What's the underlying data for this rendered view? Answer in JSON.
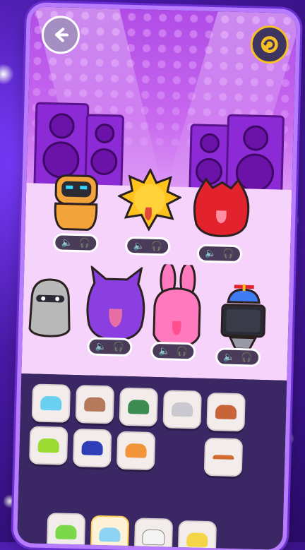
{
  "app": {
    "title": ""
  },
  "controls": {
    "back_icon": "arrow-left-icon",
    "reset_icon": "refresh-icon"
  },
  "characters": [
    {
      "name": "orange-robot",
      "color": "#f2a33a"
    },
    {
      "name": "sun",
      "color": "#ffc21d"
    },
    {
      "name": "red-monster",
      "color": "#e2232e"
    },
    {
      "name": "grey-blob",
      "color": "#b9b9b9"
    },
    {
      "name": "purple-demon",
      "color": "#8b3fe0"
    },
    {
      "name": "pink-bunny",
      "color": "#ff79be"
    },
    {
      "name": "tv-head-propeller",
      "color": "#2b2b36"
    }
  ],
  "sound_pill": {
    "speaker_icon": "speaker-icon",
    "headphones_icon": "headphones-icon"
  },
  "accessories": [
    {
      "name": "blue-cloud-hat",
      "color": "#6ad0f2"
    },
    {
      "name": "brown-cowboy-hat",
      "color": "#b57a5b"
    },
    {
      "name": "green-plant-hat",
      "color": "#3d8d52"
    },
    {
      "name": "grey-cat-ears",
      "color": "#c9c9cf"
    },
    {
      "name": "brown-round-hat",
      "color": "#c9633a"
    },
    {
      "name": "green-spiky-hair",
      "color": "#9bdb34"
    },
    {
      "name": "navy-cap",
      "color": "#2f3db8"
    },
    {
      "name": "orange-headphones",
      "color": "#f2943a"
    },
    {
      "name": "antenna-headband",
      "color": "#d46a30"
    },
    {
      "name": "green-slime",
      "color": "#7ad84a"
    },
    {
      "name": "ufo-hat",
      "color": "#8ed3f3"
    },
    {
      "name": "white-cat-ears",
      "color": "#f4f4f4"
    },
    {
      "name": "yellow-antenna-hat",
      "color": "#f4d548"
    }
  ]
}
